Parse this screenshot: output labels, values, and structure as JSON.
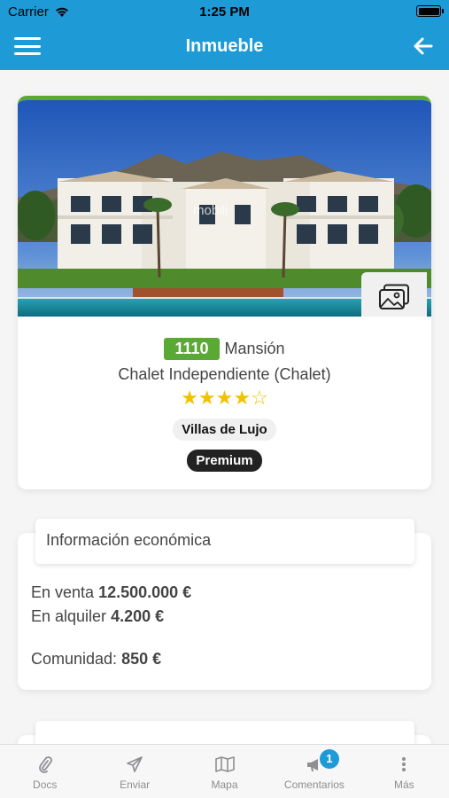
{
  "status_bar": {
    "carrier": "Carrier",
    "time": "1:25 PM",
    "battery_level": 1.0
  },
  "nav": {
    "title": "Inmueble",
    "menu_icon": "hamburger-icon",
    "back_icon": "arrow-left-icon"
  },
  "property": {
    "reference": "1110",
    "type": "Mansión",
    "subtype": "Chalet Independiente (Chalet)",
    "rating": 4,
    "rating_max": 5,
    "stars": "★★★★☆",
    "tag": "Villas de Lujo",
    "badge": "Premium",
    "watermark": "mobili",
    "accent_color": "#5aa934"
  },
  "economic": {
    "header": "Información económica",
    "sale_label": "En venta",
    "sale_value": "12.500.000 €",
    "rent_label": "En alquiler",
    "rent_value": "4.200 €",
    "community_label": "Comunidad:",
    "community_value": "850 €"
  },
  "tabs": [
    {
      "label": "Docs",
      "icon": "paperclip-icon"
    },
    {
      "label": "Enviar",
      "icon": "send-icon"
    },
    {
      "label": "Mapa",
      "icon": "map-icon"
    },
    {
      "label": "Comentarios",
      "icon": "megaphone-icon",
      "badge": "1"
    },
    {
      "label": "Más",
      "icon": "more-icon"
    }
  ],
  "colors": {
    "primary": "#1e9bd7",
    "accent": "#5aa934",
    "stars": "#f2c200"
  }
}
